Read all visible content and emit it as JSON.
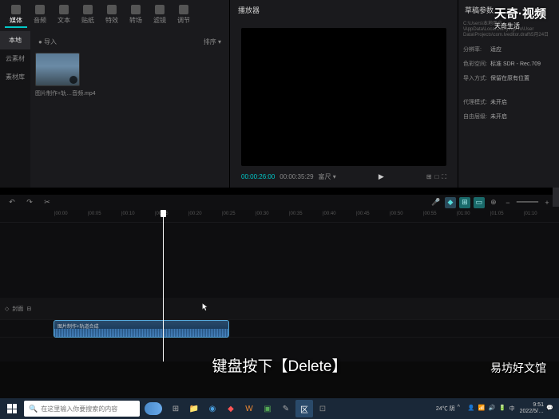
{
  "topTabs": [
    {
      "label": "媒体"
    },
    {
      "label": "音频"
    },
    {
      "label": "文本"
    },
    {
      "label": "贴纸"
    },
    {
      "label": "特效"
    },
    {
      "label": "转场"
    },
    {
      "label": "滤镜"
    },
    {
      "label": "调节"
    }
  ],
  "sidebar": {
    "local": "本地",
    "cloud": "云素材",
    "library": "素材库"
  },
  "media": {
    "import": "● 导入",
    "sort": "排序 ▾",
    "thumbLabel": "图片制作+轨…音频.mp4"
  },
  "player": {
    "title": "播放器",
    "curTime": "00:00:26:00",
    "totalTime": "00:00:35:29",
    "ratio": "富尺 ▾",
    "rightIcons": [
      "⊞",
      "□",
      "⛶"
    ]
  },
  "inspector": {
    "title": "草稿参数",
    "path": "C:\\Users\\本地用户\\AppData\\Local\\JianyingPro\\User Data\\Projects\\com.lveditor.draft\\5月24日",
    "rows": {
      "resolution": {
        "label": "分辨率:",
        "value": "适应"
      },
      "colorSpace": {
        "label": "色彩空间:",
        "value": "标准 SDR - Rec.709"
      },
      "importMode": {
        "label": "导入方式:",
        "value": "保留在原有位置"
      },
      "proxy": {
        "label": "代理模式:",
        "value": "未开启"
      },
      "freeLayer": {
        "label": "自由层级:",
        "value": "未开启"
      }
    }
  },
  "timeline": {
    "ticks": [
      "|00:00",
      "|00:05",
      "|00:10",
      "|00:15",
      "|00:20",
      "|00:25",
      "|00:30",
      "|00:35",
      "|00:40",
      "|00:45",
      "|00:50",
      "|00:55",
      "|01:00",
      "|01:05",
      "|01:10"
    ],
    "trackLock": "🔒",
    "trackMute": "封面",
    "clipLabel": "图片制作+轨道合成"
  },
  "subtitle": "键盘按下【Delete】",
  "watermarkTop": "天奇·视频",
  "watermarkTopSub": "天奇生活",
  "watermarkBottom": "易坊好文馆",
  "taskbar": {
    "searchPlaceholder": "在这里输入你要搜索的内容",
    "weather": "24℃ 阴",
    "time": "9:51",
    "date": "2022/5/…"
  }
}
